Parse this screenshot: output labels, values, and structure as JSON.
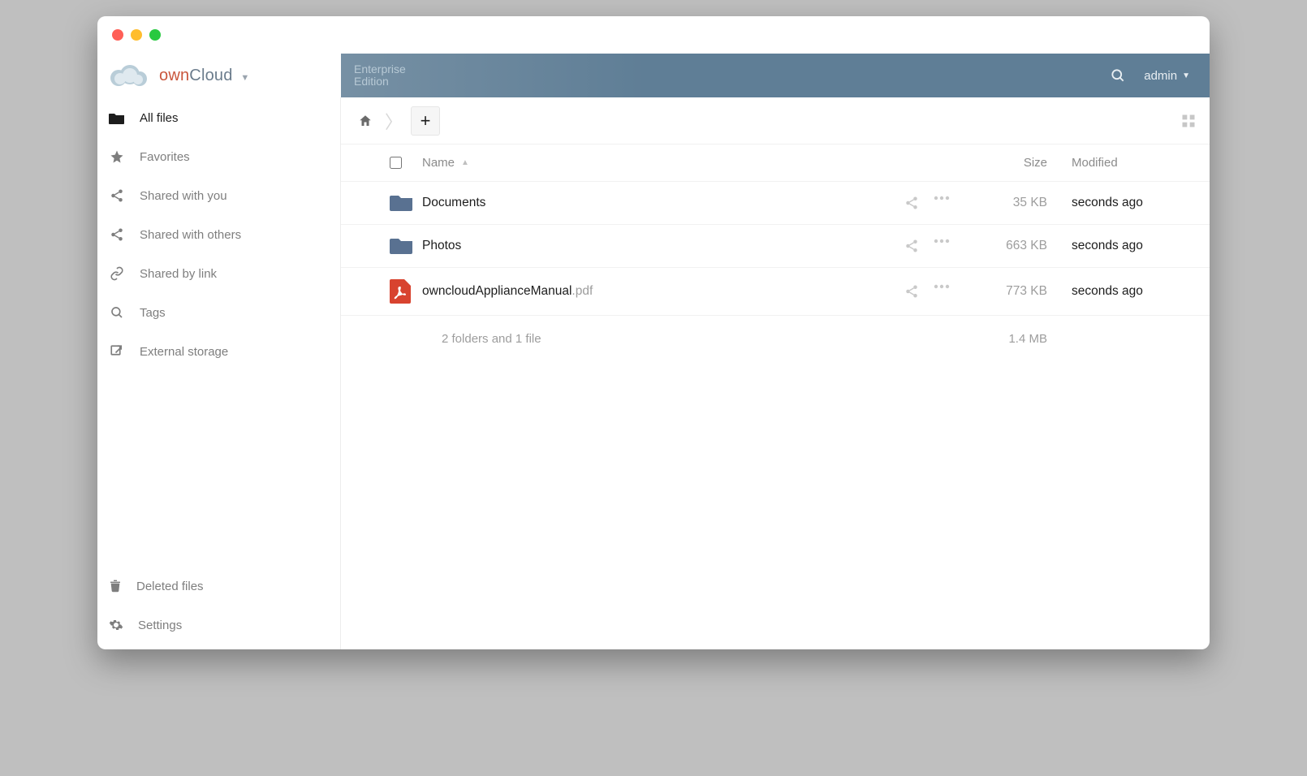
{
  "brand": {
    "own": "own",
    "cloud": "Cloud"
  },
  "edition_line1": "Enterprise",
  "edition_line2": "Edition",
  "user": "admin",
  "sidebar": {
    "items": [
      {
        "label": "All files"
      },
      {
        "label": "Favorites"
      },
      {
        "label": "Shared with you"
      },
      {
        "label": "Shared with others"
      },
      {
        "label": "Shared by link"
      },
      {
        "label": "Tags"
      },
      {
        "label": "External storage"
      }
    ],
    "bottom": [
      {
        "label": "Deleted files"
      },
      {
        "label": "Settings"
      }
    ]
  },
  "columns": {
    "name": "Name",
    "size": "Size",
    "modified": "Modified"
  },
  "files": [
    {
      "name": "Documents",
      "ext": "",
      "type": "folder",
      "size": "35 KB",
      "modified": "seconds ago"
    },
    {
      "name": "Photos",
      "ext": "",
      "type": "folder",
      "size": "663 KB",
      "modified": "seconds ago"
    },
    {
      "name": "owncloudApplianceManual",
      "ext": ".pdf",
      "type": "pdf",
      "size": "773 KB",
      "modified": "seconds ago"
    }
  ],
  "summary": {
    "text": "2 folders and 1 file",
    "size": "1.4 MB"
  }
}
